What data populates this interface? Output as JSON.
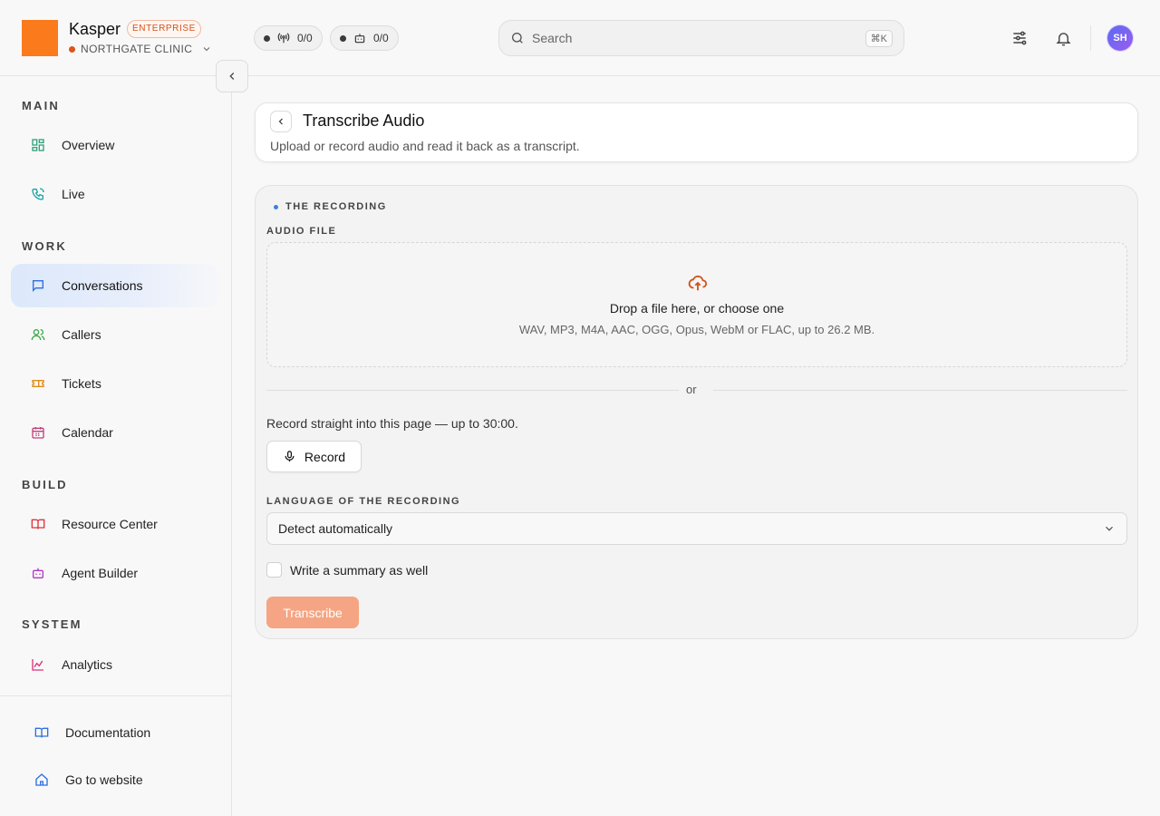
{
  "brand": {
    "name": "Kasper",
    "plan": "ENTERPRISE",
    "org": "NORTHGATE CLINIC"
  },
  "header": {
    "calls_count": "0/0",
    "agents_count": "0/0",
    "search_placeholder": "Search",
    "search_shortcut": "⌘K",
    "avatar_initials": "SH"
  },
  "sidebar": {
    "sections": {
      "main": "MAIN",
      "work": "WORK",
      "build": "BUILD",
      "system": "SYSTEM"
    },
    "items": {
      "overview": "Overview",
      "live": "Live",
      "conversations": "Conversations",
      "callers": "Callers",
      "tickets": "Tickets",
      "calendar": "Calendar",
      "resource_center": "Resource Center",
      "agent_builder": "Agent Builder",
      "analytics": "Analytics",
      "documentation": "Documentation",
      "go_to_website": "Go to website"
    },
    "active": "conversations"
  },
  "page": {
    "title": "Transcribe Audio",
    "subtitle": "Upload or record audio and read it back as a transcript."
  },
  "form": {
    "section_title": "THE RECORDING",
    "audio_label": "AUDIO FILE",
    "drop_title": "Drop a file here, or choose one",
    "drop_formats": "WAV, MP3, M4A, AAC, OGG, Opus, WebM or FLAC, up to 26.2 MB.",
    "or_text": "or",
    "record_hint": "Record straight into this page — up to 30:00.",
    "record_button": "Record",
    "language_label": "LANGUAGE OF THE RECORDING",
    "language_value": "Detect automatically",
    "summary_label": "Write a summary as well",
    "summary_checked": false,
    "submit_button": "Transcribe"
  },
  "colors": {
    "accent": "#fa7a1c",
    "active_nav": "#dce8fb",
    "submit_disabled": "#f5a583"
  }
}
